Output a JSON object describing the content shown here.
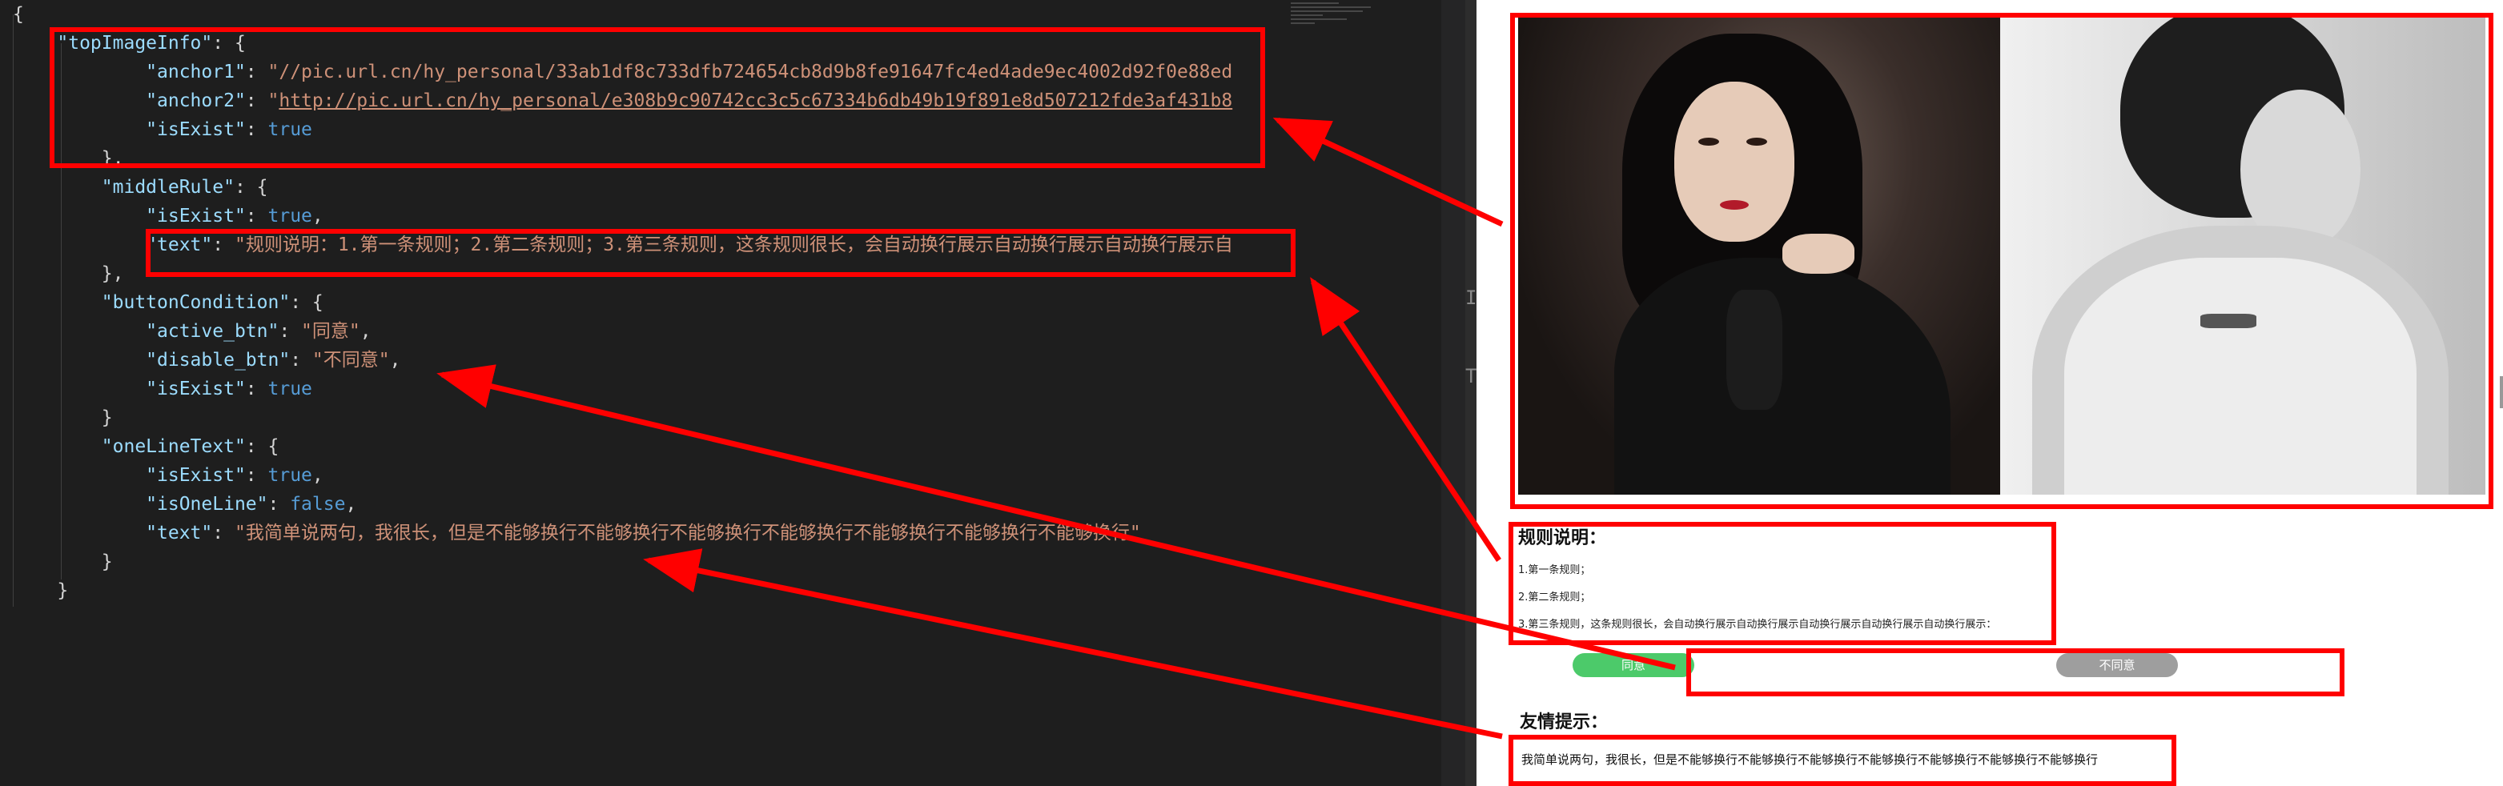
{
  "editor": {
    "lines": [
      [
        {
          "t": "{",
          "c": "p"
        }
      ],
      [
        {
          "t": "    ",
          "c": "p"
        },
        {
          "t": "\"topImageInfo\"",
          "c": "k"
        },
        {
          "t": ": {",
          "c": "p"
        }
      ],
      [
        {
          "t": "            ",
          "c": "p"
        },
        {
          "t": "\"anchor1\"",
          "c": "k"
        },
        {
          "t": ": ",
          "c": "p"
        },
        {
          "t": "\"//pic.url.cn/hy_personal/33ab1df8c733dfb724654cb8d9b8fe91647fc4ed4ade9ec4002d92f0e88ed",
          "c": "s"
        }
      ],
      [
        {
          "t": "            ",
          "c": "p"
        },
        {
          "t": "\"anchor2\"",
          "c": "k"
        },
        {
          "t": ": ",
          "c": "p"
        },
        {
          "t": "\"",
          "c": "s"
        },
        {
          "t": "http://pic.url.cn/hy_personal/e308b9c90742cc3c5c67334b6db49b19f891e8d507212fde3af431b8",
          "c": "s u"
        }
      ],
      [
        {
          "t": "            ",
          "c": "p"
        },
        {
          "t": "\"isExist\"",
          "c": "k"
        },
        {
          "t": ": ",
          "c": "p"
        },
        {
          "t": "true",
          "c": "b"
        }
      ],
      [
        {
          "t": "        },",
          "c": "p"
        }
      ],
      [
        {
          "t": "        ",
          "c": "p"
        },
        {
          "t": "\"middleRule\"",
          "c": "k"
        },
        {
          "t": ": {",
          "c": "p"
        }
      ],
      [
        {
          "t": "            ",
          "c": "p"
        },
        {
          "t": "\"isExist\"",
          "c": "k"
        },
        {
          "t": ": ",
          "c": "p"
        },
        {
          "t": "true",
          "c": "b"
        },
        {
          "t": ",",
          "c": "p"
        }
      ],
      [
        {
          "t": "            ",
          "c": "p"
        },
        {
          "t": "\"text\"",
          "c": "k"
        },
        {
          "t": ": ",
          "c": "p"
        },
        {
          "t": "\"规则说明：1.第一条规则；2.第二条规则；3.第三条规则，这条规则很长，会自动换行展示自动换行展示自动换行展示自",
          "c": "s"
        }
      ],
      [
        {
          "t": "        },",
          "c": "p"
        }
      ],
      [
        {
          "t": "        ",
          "c": "p"
        },
        {
          "t": "\"buttonCondition\"",
          "c": "k"
        },
        {
          "t": ": {",
          "c": "p"
        }
      ],
      [
        {
          "t": "            ",
          "c": "p"
        },
        {
          "t": "\"active_btn\"",
          "c": "k"
        },
        {
          "t": ": ",
          "c": "p"
        },
        {
          "t": "\"同意\"",
          "c": "s"
        },
        {
          "t": ",",
          "c": "p"
        }
      ],
      [
        {
          "t": "            ",
          "c": "p"
        },
        {
          "t": "\"disable_btn\"",
          "c": "k"
        },
        {
          "t": ": ",
          "c": "p"
        },
        {
          "t": "\"不同意\"",
          "c": "s"
        },
        {
          "t": ",",
          "c": "p"
        }
      ],
      [
        {
          "t": "            ",
          "c": "p"
        },
        {
          "t": "\"isExist\"",
          "c": "k"
        },
        {
          "t": ": ",
          "c": "p"
        },
        {
          "t": "true",
          "c": "b"
        }
      ],
      [
        {
          "t": "        }",
          "c": "p"
        }
      ],
      [
        {
          "t": "        ",
          "c": "p"
        },
        {
          "t": "\"oneLineText\"",
          "c": "k"
        },
        {
          "t": ": {",
          "c": "p"
        }
      ],
      [
        {
          "t": "            ",
          "c": "p"
        },
        {
          "t": "\"isExist\"",
          "c": "k"
        },
        {
          "t": ": ",
          "c": "p"
        },
        {
          "t": "true",
          "c": "b"
        },
        {
          "t": ",",
          "c": "p"
        }
      ],
      [
        {
          "t": "            ",
          "c": "p"
        },
        {
          "t": "\"isOneLine\"",
          "c": "k"
        },
        {
          "t": ": ",
          "c": "p"
        },
        {
          "t": "false",
          "c": "b"
        },
        {
          "t": ",",
          "c": "p"
        }
      ],
      [
        {
          "t": "            ",
          "c": "p"
        },
        {
          "t": "\"text\"",
          "c": "k"
        },
        {
          "t": ": ",
          "c": "p"
        },
        {
          "t": "\"我简单说两句，我很长，但是不能够换行不能够换行不能够换行不能够换行不能够换行不能够换行不能够换行\"",
          "c": "s"
        }
      ],
      [
        {
          "t": "        }",
          "c": "p"
        }
      ],
      [
        {
          "t": "    }",
          "c": "p"
        }
      ]
    ]
  },
  "preview": {
    "rule": {
      "title": "规则说明：",
      "items": [
        "1.第一条规则；",
        "2.第二条规则；",
        "3.第三条规则，这条规则很长，会自动换行展示自动换行展示自动换行展示自动换行展示自动换行展示："
      ]
    },
    "buttons": {
      "agree": "同意",
      "disagree": "不同意"
    },
    "tip": {
      "title": "友情提示：",
      "text": "我简单说两句，我很长，但是不能够换行不能够换行不能够换行不能够换行不能够换行不能够换行不能够换行"
    }
  },
  "colors": {
    "annotation": "#ff0000",
    "agree_button": "#4cca6a",
    "disagree_button": "#9e9e9e"
  }
}
